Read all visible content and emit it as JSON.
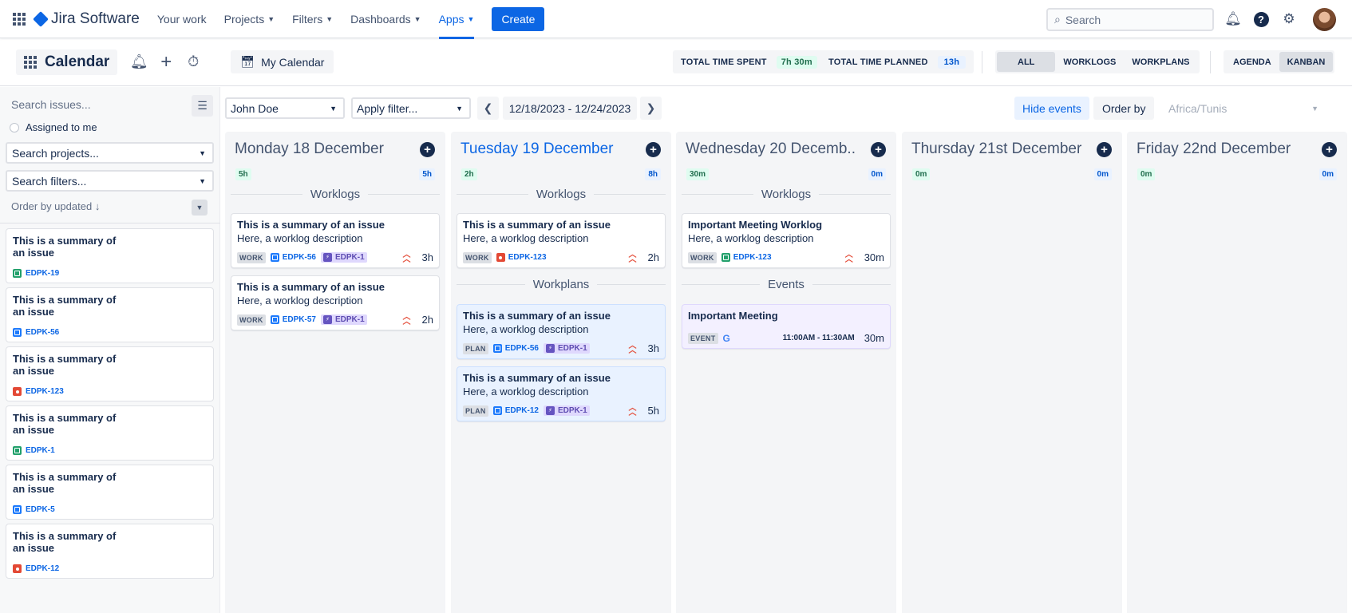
{
  "topnav": {
    "product": "Jira Software",
    "items": [
      {
        "label": "Your work",
        "dropdown": false
      },
      {
        "label": "Projects",
        "dropdown": true
      },
      {
        "label": "Filters",
        "dropdown": true
      },
      {
        "label": "Dashboards",
        "dropdown": true
      },
      {
        "label": "Apps",
        "dropdown": true,
        "active": true
      }
    ],
    "create_label": "Create",
    "search_placeholder": "Search"
  },
  "subbar": {
    "title": "Calendar",
    "my_calendar": "My Calendar",
    "total_spent_label": "TOTAL TIME SPENT",
    "total_spent_value": "7h 30m",
    "total_planned_label": "TOTAL TIME PLANNED",
    "total_planned_value": "13h",
    "filters": [
      "ALL",
      "WORKLOGS",
      "WORKPLANS"
    ],
    "active_filter": "ALL",
    "views": [
      "AGENDA",
      "KANBAN"
    ],
    "active_view": "KANBAN"
  },
  "sidebar": {
    "search_placeholder": "Search issues...",
    "assigned_to_me": "Assigned to me",
    "projects_placeholder": "Search projects...",
    "filters_placeholder": "Search filters...",
    "order_label": "Order by updated",
    "issues": [
      {
        "summary": "This is a summary of an issue",
        "key": "EDPK-19",
        "type": "story"
      },
      {
        "summary": "This is a summary of an issue",
        "key": "EDPK-56",
        "type": "task"
      },
      {
        "summary": "This is a summary of an issue",
        "key": "EDPK-123",
        "type": "bug"
      },
      {
        "summary": "This is a summary of an issue",
        "key": "EDPK-1",
        "type": "story"
      },
      {
        "summary": "This is a summary of an issue",
        "key": "EDPK-5",
        "type": "task"
      },
      {
        "summary": "This is a summary of an issue",
        "key": "EDPK-12",
        "type": "bug"
      }
    ]
  },
  "toolbar": {
    "user": "John Doe",
    "filter_placeholder": "Apply filter...",
    "date_range": "12/18/2023 - 12/24/2023",
    "hide_events": "Hide events",
    "order_by": "Order by",
    "timezone": "Africa/Tunis"
  },
  "labels": {
    "worklogs": "Worklogs",
    "workplans": "Workplans",
    "events": "Events",
    "work": "WORK",
    "plan": "PLAN",
    "event": "EVENT"
  },
  "days": [
    {
      "title": "Monday 18 December",
      "spent": "5h",
      "planned": "5h",
      "today": false,
      "worklogs": [
        {
          "summary": "This is a summary of an issue",
          "description": "Here, a worklog description",
          "key": "EDPK-56",
          "key_type": "task",
          "parent": "EDPK-1",
          "duration": "3h"
        },
        {
          "summary": "This is a summary of an issue",
          "description": "Here, a worklog description",
          "key": "EDPK-57",
          "key_type": "task",
          "parent": "EDPK-1",
          "duration": "2h"
        }
      ]
    },
    {
      "title": "Tuesday 19 December",
      "spent": "2h",
      "planned": "8h",
      "today": true,
      "worklogs": [
        {
          "summary": "This is a summary of an issue",
          "description": "Here, a worklog description",
          "key": "EDPK-123",
          "key_type": "bug",
          "duration": "2h"
        }
      ],
      "workplans": [
        {
          "summary": "This is a summary of an issue",
          "description": "Here, a worklog description",
          "key": "EDPK-56",
          "key_type": "task",
          "parent": "EDPK-1",
          "duration": "3h"
        },
        {
          "summary": "This is a summary of an issue",
          "description": "Here, a worklog description",
          "key": "EDPK-12",
          "key_type": "task",
          "parent": "EDPK-1",
          "duration": "5h"
        }
      ]
    },
    {
      "title": "Wednesday 20 Decemb..",
      "spent": "30m",
      "planned": "0m",
      "today": false,
      "worklogs": [
        {
          "summary": "Important Meeting Worklog",
          "description": "Here, a worklog description",
          "key": "EDPK-123",
          "key_type": "story",
          "duration": "30m"
        }
      ],
      "events": [
        {
          "title": "Important Meeting",
          "time": "11:00AM - 11:30AM",
          "duration": "30m"
        }
      ]
    },
    {
      "title": "Thursday 21st December",
      "spent": "0m",
      "planned": "0m",
      "today": false
    },
    {
      "title": "Friday 22nd December",
      "spent": "0m",
      "planned": "0m",
      "today": false
    }
  ],
  "colors": {
    "brand": "#0c66e4",
    "spent_bg": "#dffcf0",
    "planned_bg": "#e9f2ff",
    "priority": "#e34935"
  }
}
